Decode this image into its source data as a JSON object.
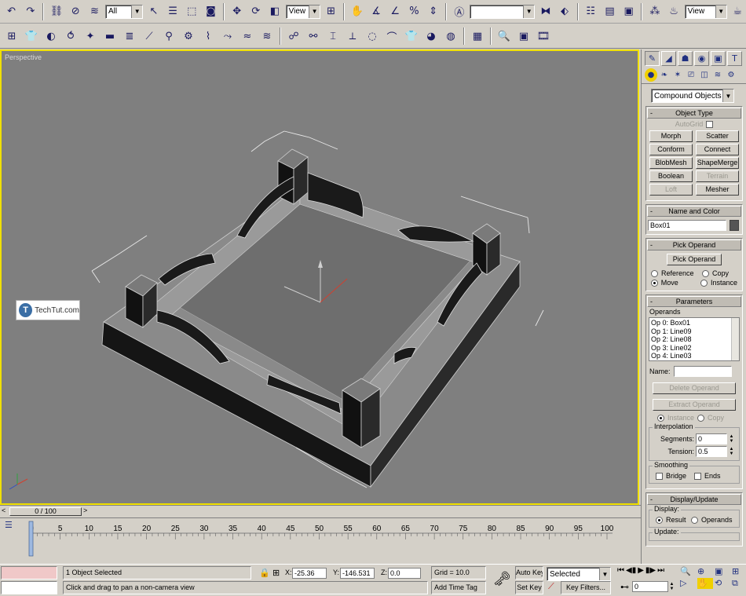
{
  "toolbar1": {
    "selection_filter": "All",
    "ref_coord_system": "View",
    "named_selection_placeholder": "",
    "viewport_layout_dropdown": "View"
  },
  "viewport": {
    "label": "Perspective"
  },
  "watermark": {
    "logo_letter": "T",
    "text": "TechTut.com"
  },
  "command_panel": {
    "category_dropdown": "Compound Objects",
    "object_type": {
      "title": "Object Type",
      "autogrid_label": "AutoGrid",
      "buttons": [
        {
          "label": "Morph",
          "enabled": true
        },
        {
          "label": "Scatter",
          "enabled": true
        },
        {
          "label": "Conform",
          "enabled": true
        },
        {
          "label": "Connect",
          "enabled": true
        },
        {
          "label": "BlobMesh",
          "enabled": true
        },
        {
          "label": "ShapeMerge",
          "enabled": true
        },
        {
          "label": "Boolean",
          "enabled": true
        },
        {
          "label": "Terrain",
          "enabled": false
        },
        {
          "label": "Loft",
          "enabled": false
        },
        {
          "label": "Mesher",
          "enabled": true
        }
      ]
    },
    "name_color": {
      "title": "Name and Color",
      "name_value": "Box01",
      "color": "#555555"
    },
    "pick_operand": {
      "title": "Pick Operand",
      "button_label": "Pick Operand",
      "reference_label": "Reference",
      "copy_label": "Copy",
      "move_label": "Move",
      "instance_label": "Instance",
      "selected_mode": "Move"
    },
    "parameters": {
      "title": "Parameters",
      "operands_label": "Operands",
      "operands": [
        "Op 0: Box01",
        "Op 1: Line09",
        "Op 2: Line08",
        "Op 3: Line02",
        "Op 4: Line03"
      ],
      "name_label": "Name:",
      "name_value": "",
      "delete_operand_label": "Delete Operand",
      "extract_operand_label": "Extract Operand",
      "instance_label": "Instance",
      "copy_label": "Copy"
    },
    "interpolation": {
      "label": "Interpolation",
      "segments_label": "Segments:",
      "segments_value": "0",
      "tension_label": "Tension:",
      "tension_value": "0.5"
    },
    "smoothing": {
      "label": "Smoothing",
      "bridge_label": "Bridge",
      "ends_label": "Ends"
    },
    "display_update": {
      "title": "Display/Update",
      "display_label": "Display:",
      "result_label": "Result",
      "operands_label": "Operands",
      "update_label": "Update:"
    }
  },
  "timeline": {
    "slider_label": "0 / 100",
    "ticks": [
      "0",
      "5",
      "10",
      "15",
      "20",
      "25",
      "30",
      "35",
      "40",
      "45",
      "50",
      "55",
      "60",
      "65",
      "70",
      "75",
      "80",
      "85",
      "90",
      "95",
      "100"
    ]
  },
  "status": {
    "selection_info": "1 Object Selected",
    "prompt": "Click and drag to pan a non-camera view",
    "x_label": "X:",
    "x_value": "-25.36",
    "y_label": "Y:",
    "y_value": "-146.531",
    "z_label": "Z:",
    "z_value": "0.0",
    "grid_label": "Grid = 10.0",
    "add_time_tag": "Add Time Tag",
    "auto_key_label": "Auto Key",
    "set_key_label": "Set Key",
    "key_mode_value": "Selected",
    "key_filters_label": "Key Filters...",
    "current_frame": "0"
  }
}
